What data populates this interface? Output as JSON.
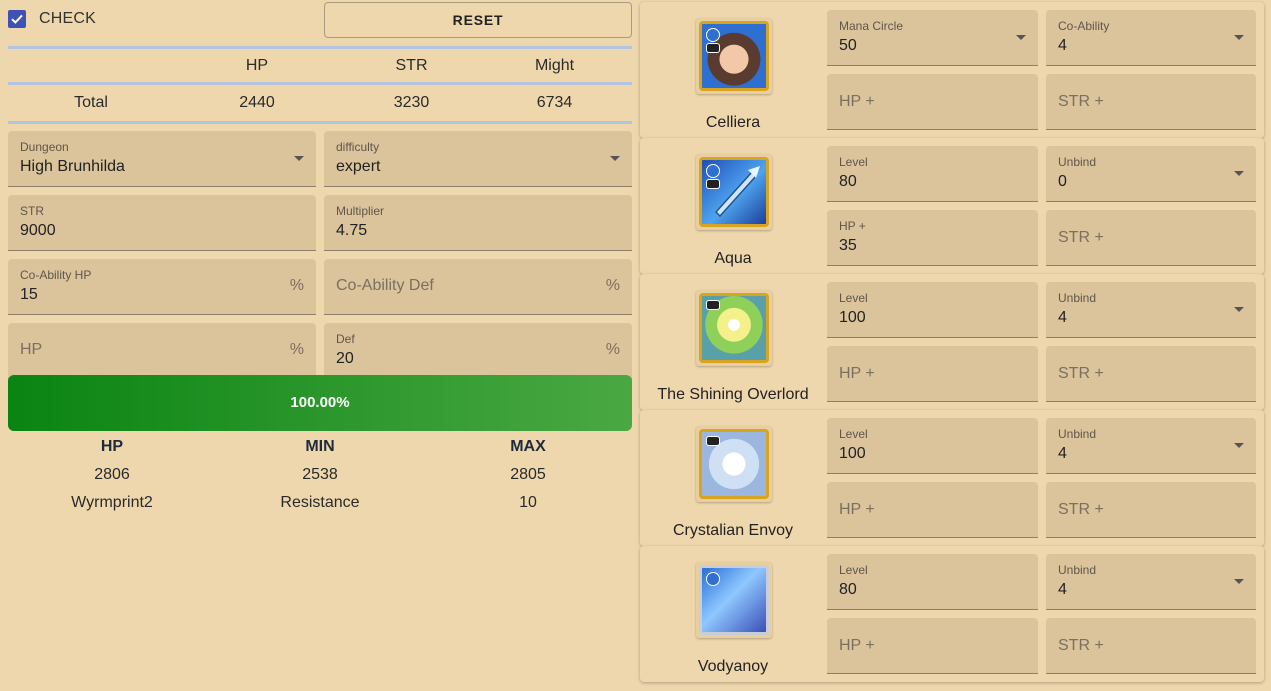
{
  "header": {
    "check_label": "CHECK",
    "reset_label": "RESET"
  },
  "stats": {
    "columns": [
      "",
      "HP",
      "STR",
      "Might"
    ],
    "total": [
      "Total",
      "2440",
      "3230",
      "6734"
    ]
  },
  "form": {
    "dungeon": {
      "label": "Dungeon",
      "value": "High Brunhilda"
    },
    "difficulty": {
      "label": "difficulty",
      "value": "expert"
    },
    "str": {
      "label": "STR",
      "value": "9000"
    },
    "multiplier": {
      "label": "Multiplier",
      "value": "4.75"
    },
    "coability_hp": {
      "label": "Co-Ability HP",
      "value": "15",
      "unit": "%"
    },
    "coability_def": {
      "placeholder": "Co-Ability Def",
      "unit": "%"
    },
    "hp": {
      "placeholder": "HP",
      "unit": "%"
    },
    "def": {
      "label": "Def",
      "value": "20",
      "unit": "%"
    }
  },
  "progress": {
    "value_text": "100.00%",
    "fraction": 1.0,
    "color_start": "#0a8413",
    "color_end": "#4aa843"
  },
  "results": {
    "headers": [
      "HP",
      "MIN",
      "MAX"
    ],
    "row1": [
      "2806",
      "2538",
      "2805"
    ],
    "row2": [
      "Wyrmprint2",
      "Resistance",
      "10"
    ]
  },
  "units": [
    {
      "name": "Celliera",
      "icon": "adventurer-portrait-icon",
      "f1": {
        "label": "Mana Circle",
        "value": "50"
      },
      "f2": {
        "label": "Co-Ability",
        "value": "4"
      },
      "f3": {
        "placeholder": "HP +"
      },
      "f4": {
        "placeholder": "STR +"
      }
    },
    {
      "name": "Aqua",
      "icon": "dragon-spear-portrait-icon",
      "f1": {
        "label": "Level",
        "value": "80"
      },
      "f2": {
        "label": "Unbind",
        "value": "0"
      },
      "f3": {
        "label": "HP +",
        "value": "35"
      },
      "f4": {
        "placeholder": "STR +"
      }
    },
    {
      "name": "The Shining Overlord",
      "icon": "wyrmprint-portrait-icon",
      "f1": {
        "label": "Level",
        "value": "100"
      },
      "f2": {
        "label": "Unbind",
        "value": "4"
      },
      "f3": {
        "placeholder": "HP +"
      },
      "f4": {
        "placeholder": "STR +"
      }
    },
    {
      "name": "Crystalian Envoy",
      "icon": "wyrmprint-portrait-icon",
      "f1": {
        "label": "Level",
        "value": "100"
      },
      "f2": {
        "label": "Unbind",
        "value": "4"
      },
      "f3": {
        "placeholder": "HP +"
      },
      "f4": {
        "placeholder": "STR +"
      }
    },
    {
      "name": "Vodyanoy",
      "icon": "dragon-portrait-icon",
      "f1": {
        "label": "Level",
        "value": "80"
      },
      "f2": {
        "label": "Unbind",
        "value": "4"
      },
      "f3": {
        "placeholder": "HP +"
      },
      "f4": {
        "placeholder": "STR +"
      }
    }
  ]
}
